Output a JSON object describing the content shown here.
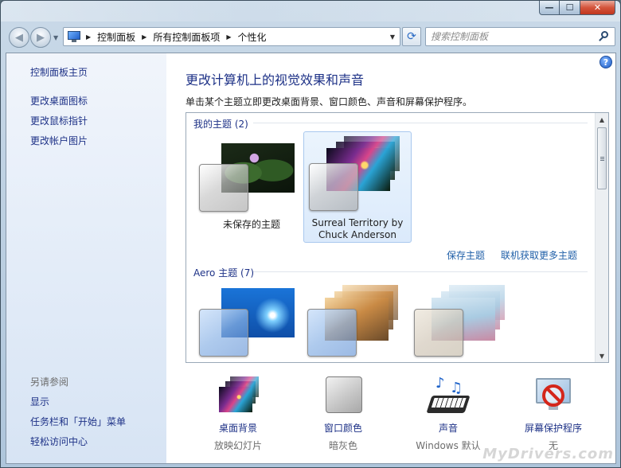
{
  "window": {
    "caption_buttons": {
      "minimize": "—",
      "maximize": "☐",
      "close": "✕"
    }
  },
  "nav": {
    "breadcrumb": [
      "控制面板",
      "所有控制面板项",
      "个性化"
    ],
    "search_placeholder": "搜索控制面板"
  },
  "sidebar": {
    "home": "控制面板主页",
    "links": [
      "更改桌面图标",
      "更改鼠标指针",
      "更改帐户图片"
    ],
    "see_also_title": "另请参阅",
    "see_also": [
      "显示",
      "任务栏和「开始」菜单",
      "轻松访问中心"
    ]
  },
  "main": {
    "help_icon": "?",
    "title": "更改计算机上的视觉效果和声音",
    "description": "单击某个主题立即更改桌面背景、窗口颜色、声音和屏幕保护程序。",
    "my_themes": {
      "title": "我的主题 (2)",
      "items": [
        {
          "name": "未保存的主题",
          "selected": false
        },
        {
          "name": "Surreal Territory by Chuck Anderson",
          "line1": "Surreal Territory by",
          "line2": "Chuck Anderson",
          "selected": true
        }
      ],
      "save_link": "保存主题",
      "online_link": "联机获取更多主题"
    },
    "aero_themes": {
      "title": "Aero 主题 (7)"
    }
  },
  "bottom": [
    {
      "label": "桌面背景",
      "value": "放映幻灯片"
    },
    {
      "label": "窗口颜色",
      "value": "暗灰色"
    },
    {
      "label": "声音",
      "value": "Windows 默认"
    },
    {
      "label": "屏幕保护程序",
      "value": "无"
    }
  ],
  "watermark": "MyDrivers.com"
}
